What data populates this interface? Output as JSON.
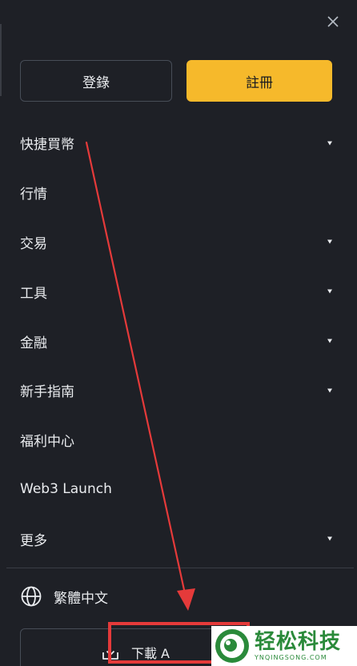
{
  "header": {
    "close_icon": "close-icon"
  },
  "auth": {
    "login_label": "登錄",
    "register_label": "註冊"
  },
  "menu": {
    "items": [
      {
        "label": "快捷買幣",
        "expandable": true
      },
      {
        "label": "行情",
        "expandable": false
      },
      {
        "label": "交易",
        "expandable": true
      },
      {
        "label": "工具",
        "expandable": true
      },
      {
        "label": "金融",
        "expandable": true
      },
      {
        "label": "新手指南",
        "expandable": true
      },
      {
        "label": "福利中心",
        "expandable": false
      },
      {
        "label": "Web3 Launch",
        "expandable": false
      },
      {
        "label": "更多",
        "expandable": true
      }
    ]
  },
  "language": {
    "icon": "globe-icon",
    "label": "繁體中文"
  },
  "download": {
    "icon": "download-icon",
    "label": "下載 A"
  },
  "watermark": {
    "title": "轻松科技",
    "subtitle": "YNQINGSONG.COM"
  },
  "colors": {
    "background": "#1e2026",
    "accent": "#f6b92b",
    "text": "#eaecef",
    "annotation": "#e53a3a",
    "watermark_green": "#2a8a3a"
  }
}
